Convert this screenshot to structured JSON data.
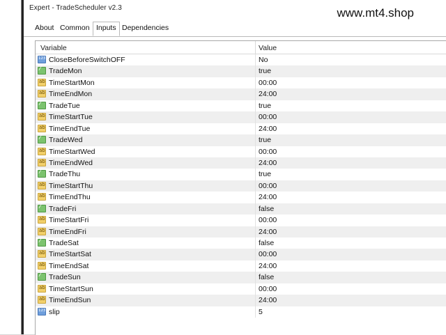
{
  "window": {
    "title": "Expert - TradeScheduler v2.3",
    "watermark": "www.mt4.shop"
  },
  "tabs": [
    {
      "label": "About",
      "active": false
    },
    {
      "label": "Common",
      "active": false
    },
    {
      "label": "Inputs",
      "active": true
    },
    {
      "label": "Dependencies",
      "active": false
    }
  ],
  "table": {
    "columns": [
      "Variable",
      "Value"
    ],
    "rows": [
      {
        "type": "num",
        "icon": "int-type-icon",
        "variable": "CloseBeforeSwitchOFF",
        "value": "No"
      },
      {
        "type": "bool",
        "icon": "bool-type-icon",
        "variable": "TradeMon",
        "value": "true"
      },
      {
        "type": "ab",
        "icon": "string-type-icon",
        "variable": "TimeStartMon",
        "value": "00:00"
      },
      {
        "type": "ab",
        "icon": "string-type-icon",
        "variable": "TimeEndMon",
        "value": "24:00"
      },
      {
        "type": "bool",
        "icon": "bool-type-icon",
        "variable": "TradeTue",
        "value": "true"
      },
      {
        "type": "ab",
        "icon": "string-type-icon",
        "variable": "TimeStartTue",
        "value": "00:00"
      },
      {
        "type": "ab",
        "icon": "string-type-icon",
        "variable": "TimeEndTue",
        "value": "24:00"
      },
      {
        "type": "bool",
        "icon": "bool-type-icon",
        "variable": "TradeWed",
        "value": "true"
      },
      {
        "type": "ab",
        "icon": "string-type-icon",
        "variable": "TimeStartWed",
        "value": "00:00"
      },
      {
        "type": "ab",
        "icon": "string-type-icon",
        "variable": "TimeEndWed",
        "value": "24:00"
      },
      {
        "type": "bool",
        "icon": "bool-type-icon",
        "variable": "TradeThu",
        "value": "true"
      },
      {
        "type": "ab",
        "icon": "string-type-icon",
        "variable": "TimeStartThu",
        "value": "00:00"
      },
      {
        "type": "ab",
        "icon": "string-type-icon",
        "variable": "TimeEndThu",
        "value": "24:00"
      },
      {
        "type": "bool",
        "icon": "bool-type-icon",
        "variable": "TradeFri",
        "value": "false"
      },
      {
        "type": "ab",
        "icon": "string-type-icon",
        "variable": "TimeStartFri",
        "value": "00:00"
      },
      {
        "type": "ab",
        "icon": "string-type-icon",
        "variable": "TimeEndFri",
        "value": "24:00"
      },
      {
        "type": "bool",
        "icon": "bool-type-icon",
        "variable": "TradeSat",
        "value": "false"
      },
      {
        "type": "ab",
        "icon": "string-type-icon",
        "variable": "TimeStartSat",
        "value": "00:00"
      },
      {
        "type": "ab",
        "icon": "string-type-icon",
        "variable": "TimeEndSat",
        "value": "24:00"
      },
      {
        "type": "bool",
        "icon": "bool-type-icon",
        "variable": "TradeSun",
        "value": "false"
      },
      {
        "type": "ab",
        "icon": "string-type-icon",
        "variable": "TimeStartSun",
        "value": "00:00"
      },
      {
        "type": "ab",
        "icon": "string-type-icon",
        "variable": "TimeEndSun",
        "value": "24:00"
      },
      {
        "type": "num",
        "icon": "int-type-icon",
        "variable": "slip",
        "value": "5"
      }
    ]
  }
}
